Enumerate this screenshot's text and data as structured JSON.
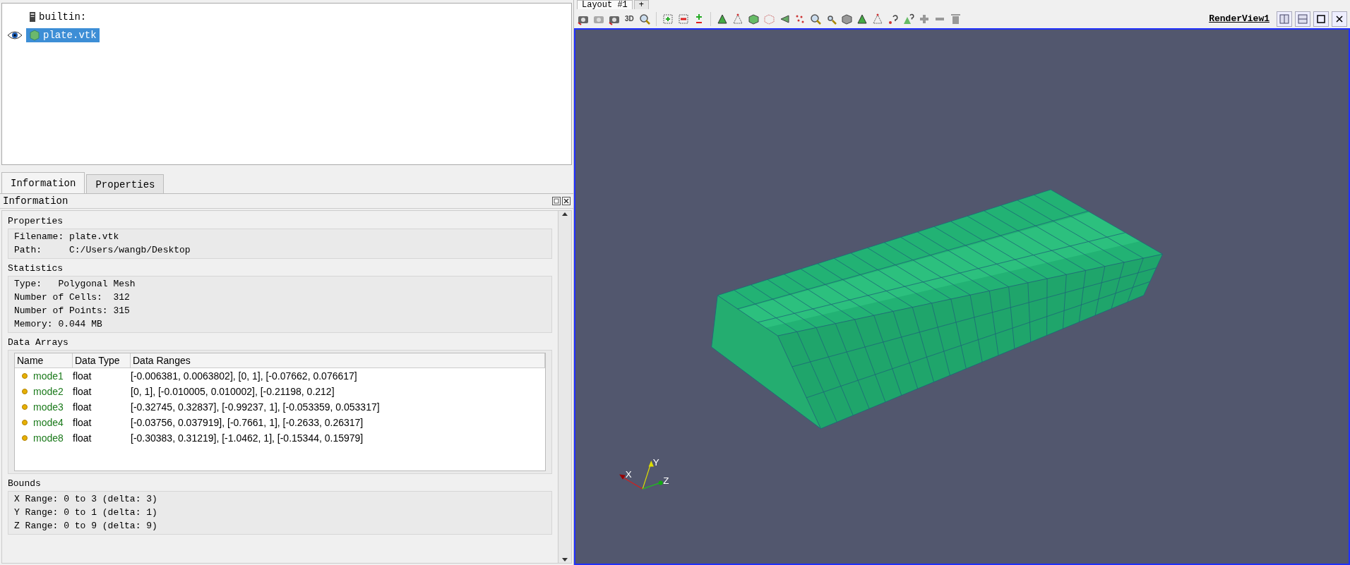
{
  "layout_tabs": [
    {
      "label": "Layout #1",
      "selected": true
    },
    {
      "label": "+",
      "selected": false
    }
  ],
  "pipeline": {
    "items": [
      {
        "label": "builtin:",
        "kind": "server",
        "visible": false,
        "selected": false,
        "children": [
          {
            "label": "plate.vtk",
            "kind": "source",
            "visible": true,
            "selected": true
          }
        ]
      }
    ]
  },
  "panel_tabs": [
    {
      "label": "Information",
      "selected": true
    },
    {
      "label": "Properties",
      "selected": false
    }
  ],
  "information": {
    "title": "Information",
    "properties": {
      "title": "Properties",
      "lines": [
        "Filename: plate.vtk",
        "Path:     C:/Users/wangb/Desktop"
      ]
    },
    "statistics": {
      "title": "Statistics",
      "lines": [
        "Type:   Polygonal Mesh",
        "Number of Cells:  312",
        "Number of Points: 315",
        "Memory: 0.044 MB"
      ]
    },
    "data_arrays": {
      "title": "Data Arrays",
      "columns": [
        "Name",
        "Data Type",
        "Data Ranges"
      ],
      "rows": [
        {
          "name": "mode1",
          "type": "float",
          "ranges": "[-0.006381, 0.0063802], [0, 1], [-0.07662, 0.076617]"
        },
        {
          "name": "mode2",
          "type": "float",
          "ranges": "[0, 1], [-0.010005, 0.010002], [-0.21198, 0.212]"
        },
        {
          "name": "mode3",
          "type": "float",
          "ranges": "[-0.32745, 0.32837], [-0.99237, 1], [-0.053359, 0.053317]"
        },
        {
          "name": "mode4",
          "type": "float",
          "ranges": "[-0.03756, 0.037919], [-0.7661, 1], [-0.2633, 0.26317]"
        },
        {
          "name": "mode8",
          "type": "float",
          "ranges": "[-0.30383, 0.31219], [-1.0462, 1], [-0.15344, 0.15979]"
        }
      ]
    },
    "bounds": {
      "title": "Bounds",
      "lines": [
        "X Range: 0 to 3 (delta: 3)",
        "Y Range: 0 to 1 (delta: 1)",
        "Z Range: 0 to 9 (delta: 9)"
      ]
    }
  },
  "toolbar": {
    "text_button": "3D",
    "view_name": "RenderView1"
  },
  "axes": {
    "x": "X",
    "y": "Y",
    "z": "Z"
  }
}
